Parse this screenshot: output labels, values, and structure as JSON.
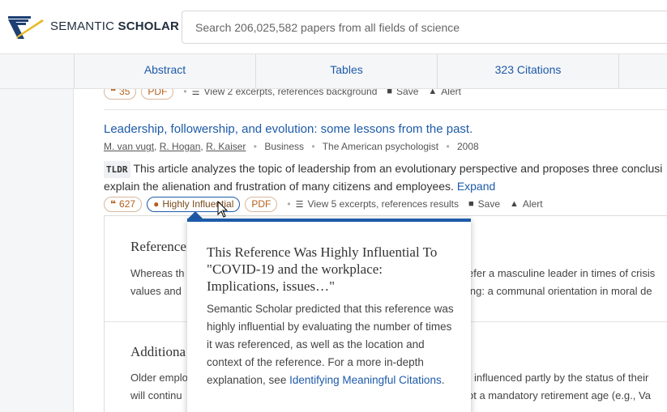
{
  "header": {
    "brand_bold_left": "SEMANTIC",
    "brand_bold_right": "SCHOLAR",
    "search_placeholder": "Search 206,025,582 papers from all fields of science"
  },
  "tabs": [
    "Abstract",
    "Tables",
    "323 Citations",
    ""
  ],
  "prev_paper": {
    "citations": "35",
    "pdf_label": "PDF",
    "excerpts": "View 2 excerpts, references background",
    "save": "Save",
    "alert": "Alert"
  },
  "paper": {
    "title": "Leadership, followership, and evolution: some lessons from the past.",
    "authors": [
      "M. van vugt",
      "R. Hogan",
      "R. Kaiser"
    ],
    "field": "Business",
    "venue": "The American psychologist",
    "year": "2008",
    "tldr_tag": "TLDR",
    "tldr_text": "This article analyzes the topic of leadership from an evolutionary perspective and proposes three conclusions… explain the alienation and frustration of many citizens and employees.",
    "tldr_line1": "This article analyzes the topic of leadership from an evolutionary perspective and proposes three conclusi",
    "tldr_line2": "explain the alienation and frustration of many citizens and employees.",
    "expand": "Expand",
    "citations": "627",
    "highly_influential": "Highly Influential",
    "pdf_label": "PDF",
    "excerpts": "View 5 excerpts, references results",
    "save": "Save",
    "alert": "Alert"
  },
  "panel": {
    "sec1_heading": "Reference",
    "sec1_line1_left": "Whereas th",
    "sec1_line1_right": "efer a masculine leader in times of crisis",
    "sec1_line2_left": "values and",
    "sec1_line2_right": "ing: a communal orientation in moral de",
    "sec2_heading": "Additiona",
    "sec2_line1_left": "Older emplo",
    "sec2_line1_right": "influenced partly by the status of their",
    "sec2_line2_left": "will continu",
    "sec2_line2_right": "ot a mandatory retirement age (e.g., Va"
  },
  "tooltip": {
    "heading": "This Reference Was Highly Influential To \"COVID-19 and the workplace: Implications, issues…\"",
    "body": "Semantic Scholar predicted that this reference was highly influential by evaluating the number of times it was referenced, as well as the location and context of the reference. For a more in-depth explanation, see",
    "link": "Identifying Meaningful Citations",
    "end": "."
  },
  "colors": {
    "link": "#1d5aa8",
    "pill_border": "#d9b79a",
    "pill_text": "#b4611c",
    "logo_blue": "#1d3f73",
    "logo_yellow": "#e8b926"
  }
}
